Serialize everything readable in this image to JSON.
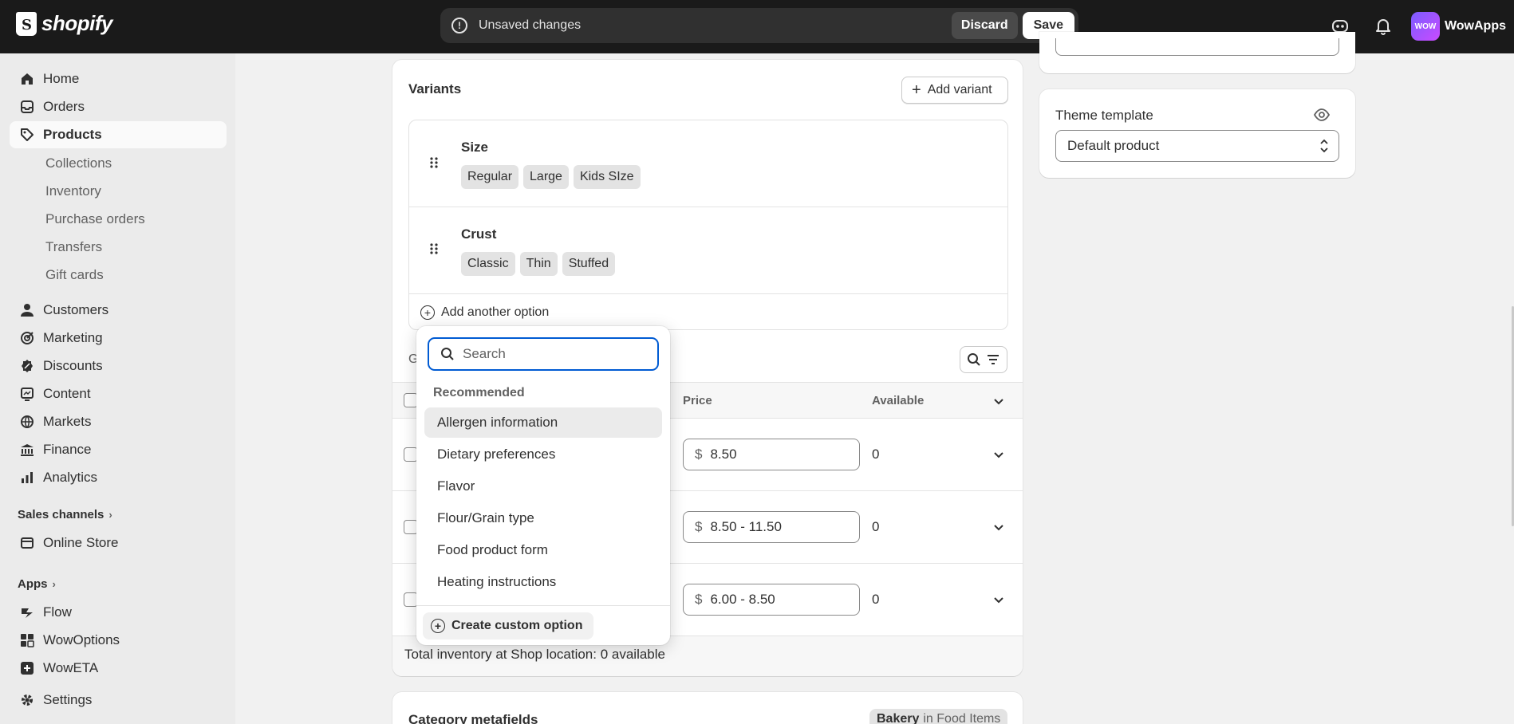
{
  "topbar": {
    "logo_text": "shopify",
    "unsaved_text": "Unsaved changes",
    "discard_label": "Discard",
    "save_label": "Save",
    "avatar_text": "WOW",
    "store_name": "WowApps"
  },
  "sidebar": {
    "items": [
      {
        "label": "Home",
        "icon": "home-icon"
      },
      {
        "label": "Orders",
        "icon": "orders-icon"
      },
      {
        "label": "Products",
        "icon": "tag-icon",
        "active": true
      }
    ],
    "product_subitems": [
      "Collections",
      "Inventory",
      "Purchase orders",
      "Transfers",
      "Gift cards"
    ],
    "items2": [
      {
        "label": "Customers",
        "icon": "person-icon"
      },
      {
        "label": "Marketing",
        "icon": "target-icon"
      },
      {
        "label": "Discounts",
        "icon": "discount-icon"
      },
      {
        "label": "Content",
        "icon": "content-icon"
      },
      {
        "label": "Markets",
        "icon": "globe-icon"
      },
      {
        "label": "Finance",
        "icon": "bank-icon"
      },
      {
        "label": "Analytics",
        "icon": "chart-icon"
      }
    ],
    "sales_channels_label": "Sales channels",
    "online_store_label": "Online Store",
    "apps_label": "Apps",
    "apps": [
      "Flow",
      "WowOptions",
      "WowETA"
    ],
    "settings_label": "Settings"
  },
  "variants": {
    "title": "Variants",
    "add_variant_label": "Add variant",
    "options": [
      {
        "name": "Size",
        "values": [
          "Regular",
          "Large",
          "Kids SIze"
        ]
      },
      {
        "name": "Crust",
        "values": [
          "Classic",
          "Thin",
          "Stuffed"
        ]
      }
    ],
    "add_another_option": "Add another option",
    "group_partial": "G",
    "columns": {
      "price": "Price",
      "available": "Available"
    },
    "rows": [
      {
        "price": "8.50",
        "available": "0"
      },
      {
        "price": "8.50 - 11.50",
        "available": "0"
      },
      {
        "price": "6.00 - 8.50",
        "available": "0"
      }
    ],
    "currency": "$",
    "total_inventory": "Total inventory at Shop location: 0 available"
  },
  "dropdown": {
    "search_placeholder": "Search",
    "section_label": "Recommended",
    "items": [
      "Allergen information",
      "Dietary preferences",
      "Flavor",
      "Flour/Grain type",
      "Food product form",
      "Heating instructions"
    ],
    "create_custom": "Create custom option"
  },
  "theme_template": {
    "title": "Theme template",
    "value": "Default product"
  },
  "category_metafields": {
    "title": "Category metafields",
    "badge_strong": "Bakery",
    "badge_rest": "in Food Items"
  },
  "colors": {
    "topbar": "#1a1a1a",
    "focus": "#005bd3",
    "background": "#f1f1f1"
  }
}
